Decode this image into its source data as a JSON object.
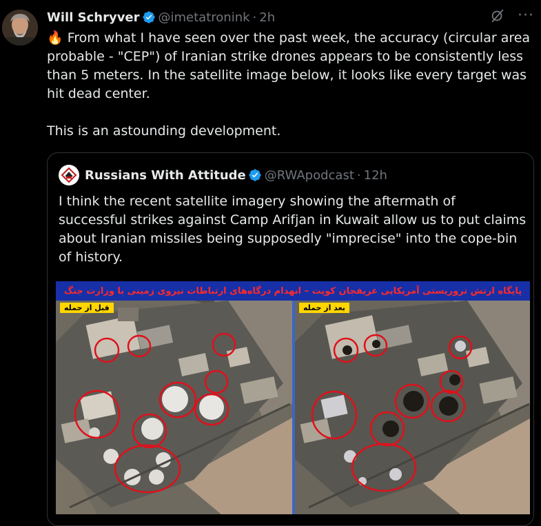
{
  "author": {
    "name": "Will Schryver",
    "handle": "@imetatronink",
    "separator": "·",
    "time": "2h"
  },
  "tweet": {
    "emoji": "🔥",
    "text": " From what I have seen over the past week, the accuracy (circular area probable - \"CEP\") of Iranian strike drones appears to be consistently less than 5 meters. In the satellite image below, it looks like every target was hit dead center.\n\nThis is an astounding development."
  },
  "quoted": {
    "name": "Russians With Attitude",
    "handle": "@RWApodcast",
    "separator": "·",
    "time": "12h",
    "text": "I think the recent satellite imagery showing the aftermath of successful strikes against Camp Arifjan in Kuwait allow us to put claims about Iranian missiles being supposedly \"imprecise\" into the cope-bin of history.",
    "image": {
      "banner": "پایگاه ارتش تروریستی آمریکایی عریفجان کویت – انهدام درگاه‌های ارتباطات نیروی زمینی با وزارت جنگ",
      "label_before": "قبل از حمله",
      "label_after": "بعد از حمله"
    }
  },
  "icons": {
    "verified": "verified-badge-icon",
    "grok": "grok-icon",
    "more": "more-icon"
  },
  "colors": {
    "verified": "#1d9bf0",
    "banner_bg": "#1730a8",
    "banner_text": "#ff2a2a",
    "tag_bg": "#ffd600",
    "circle": "#e0101a"
  }
}
